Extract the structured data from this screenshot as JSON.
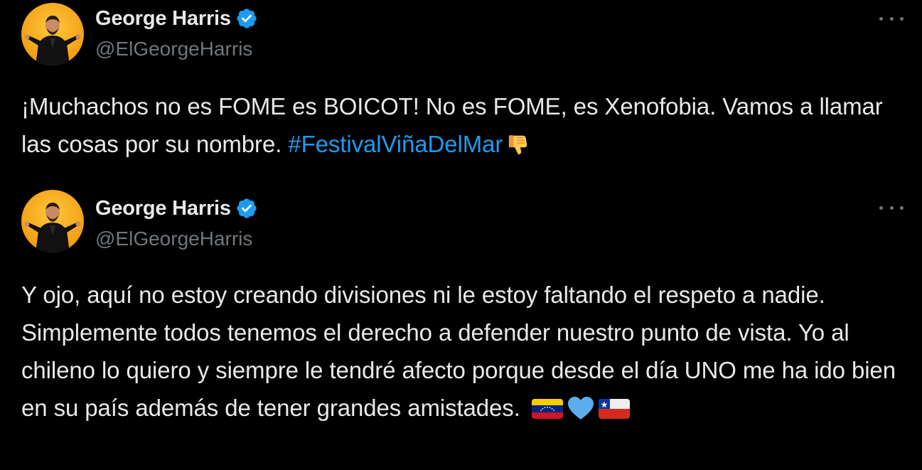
{
  "tweets": [
    {
      "author": {
        "name": "George Harris",
        "handle": "@ElGeorgeHarris",
        "verified": true
      },
      "text": "¡Muchachos no es FOME es BOICOT! No es FOME, es Xenofobia. Vamos a llamar las cosas por su nombre. ",
      "hashtag": "#FestivalViñaDelMar",
      "emojis": [
        "thumbs-down-icon"
      ]
    },
    {
      "author": {
        "name": "George Harris",
        "handle": "@ElGeorgeHarris",
        "verified": true
      },
      "text": "Y ojo, aquí no estoy creando divisiones ni le estoy faltando el respeto a nadie. Simplemente todos tenemos el derecho a defender nuestro punto de vista. Yo al chileno lo quiero y siempre le tendré afecto porque desde el día UNO me ha ido bien en su país además de tener grandes amistades. ",
      "emojis": [
        "venezuela-flag-icon",
        "blue-heart-icon",
        "chile-flag-icon"
      ]
    }
  ],
  "colors": {
    "background": "#000000",
    "text": "#e7e9ea",
    "secondary": "#71767b",
    "link": "#1d9bf0",
    "verified": "#1d9bf0",
    "avatar_bg": "#f4a51c"
  }
}
